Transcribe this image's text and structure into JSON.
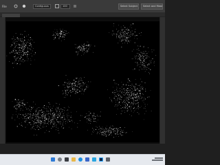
{
  "options_bar": {
    "file_menu_text": "File",
    "mode_label": "Contiguous",
    "zoom_value": "100",
    "select_subject_label": "Select Subject",
    "select_and_mask_label": "Select and Mask..."
  },
  "canvas": {
    "description_colors": {
      "background": "#000000",
      "particles": "#ffffff"
    }
  },
  "taskbar": {
    "icons": [
      "start-icon",
      "search-icon",
      "task-view-icon",
      "file-explorer-icon",
      "edge-icon",
      "store-icon",
      "mail-icon",
      "photoshop-icon",
      "settings-icon"
    ]
  }
}
